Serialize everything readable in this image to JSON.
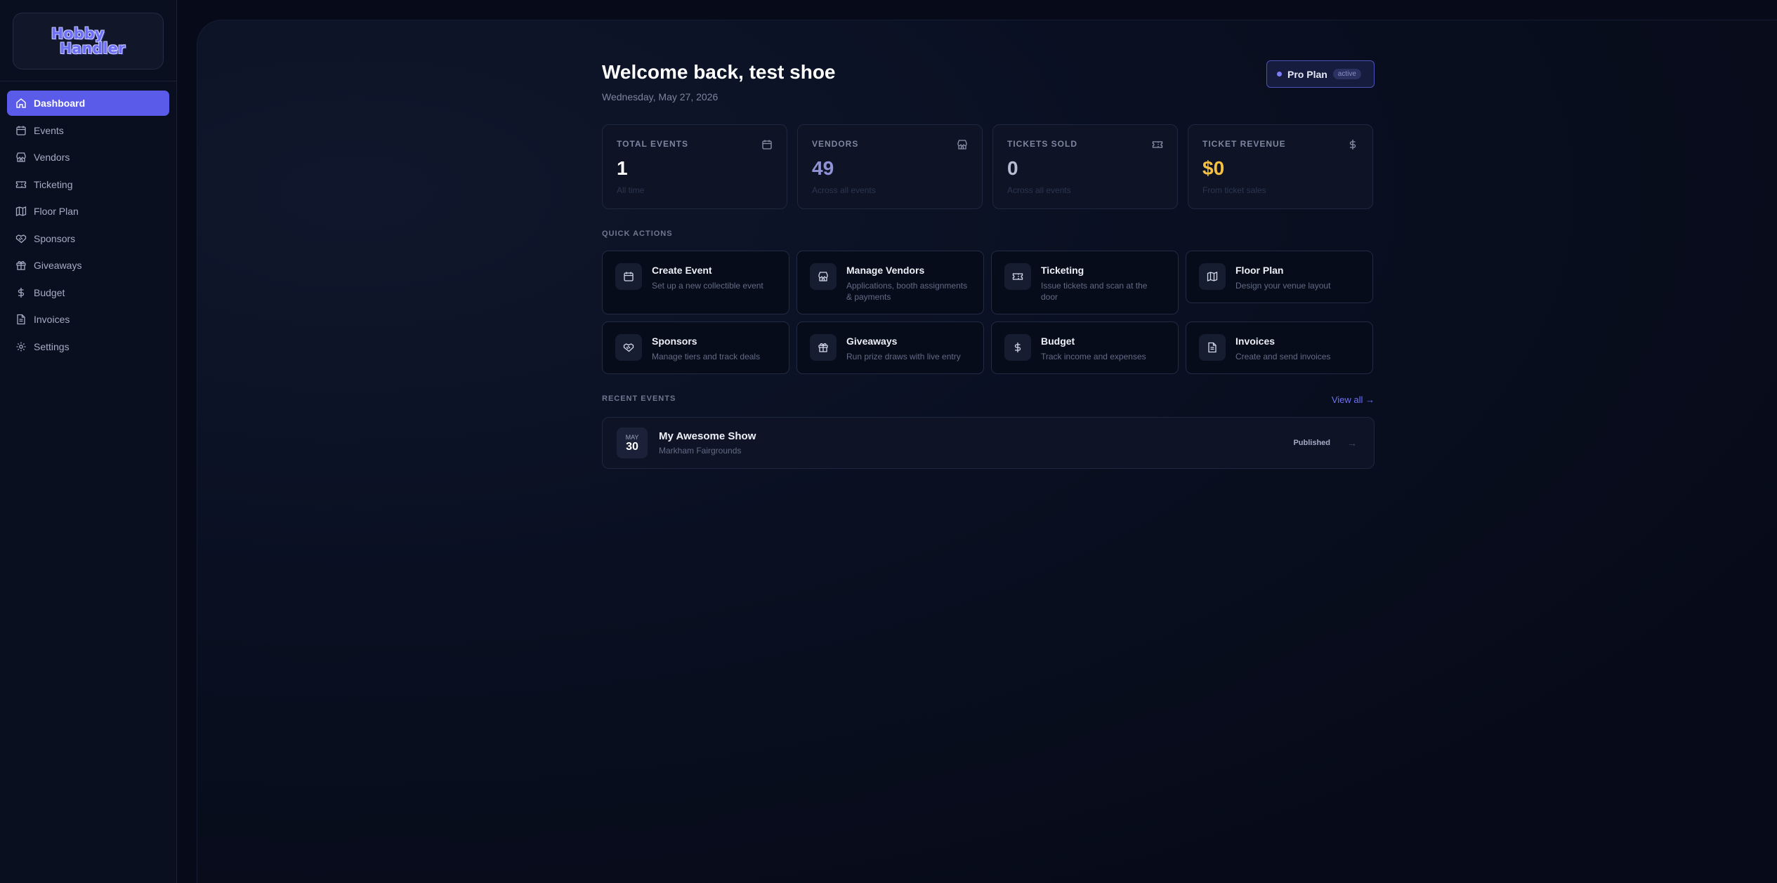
{
  "app": {
    "logo_line1": "Hobby",
    "logo_line2": "Handler"
  },
  "sidebar": {
    "items": [
      {
        "label": "Dashboard",
        "icon": "home-icon",
        "active": true
      },
      {
        "label": "Events",
        "icon": "calendar-icon"
      },
      {
        "label": "Vendors",
        "icon": "store-icon"
      },
      {
        "label": "Ticketing",
        "icon": "ticket-icon"
      },
      {
        "label": "Floor Plan",
        "icon": "map-icon"
      },
      {
        "label": "Sponsors",
        "icon": "handshake-icon"
      },
      {
        "label": "Giveaways",
        "icon": "gift-icon"
      },
      {
        "label": "Budget",
        "icon": "dollar-icon"
      },
      {
        "label": "Invoices",
        "icon": "file-icon"
      },
      {
        "label": "Settings",
        "icon": "gear-icon"
      }
    ]
  },
  "header": {
    "title": "Welcome back, test shoe",
    "date": "Wednesday, May 27, 2026",
    "plan_label": "Pro Plan",
    "plan_badge": "active"
  },
  "stats": [
    {
      "label": "TOTAL EVENTS",
      "value": "1",
      "sub": "All time",
      "icon": "calendar-icon",
      "color": "#ffffff"
    },
    {
      "label": "VENDORS",
      "value": "49",
      "sub": "Across all events",
      "icon": "store-icon",
      "color": "#8f93d6"
    },
    {
      "label": "TICKETS SOLD",
      "value": "0",
      "sub": "Across all events",
      "icon": "ticket-icon",
      "color": "#b6bdd2"
    },
    {
      "label": "TICKET REVENUE",
      "value": "$0",
      "sub": "From ticket sales",
      "icon": "dollar-icon",
      "color": "#f4c041"
    }
  ],
  "quick_actions": {
    "label": "QUICK ACTIONS",
    "items": [
      {
        "title": "Create Event",
        "desc": "Set up a new collectible event",
        "icon": "calendar-icon"
      },
      {
        "title": "Manage Vendors",
        "desc": "Applications, booth assignments & payments",
        "icon": "store-icon"
      },
      {
        "title": "Ticketing",
        "desc": "Issue tickets and scan at the door",
        "icon": "ticket-icon"
      },
      {
        "title": "Floor Plan",
        "desc": "Design your venue layout",
        "icon": "map-icon"
      },
      {
        "title": "Sponsors",
        "desc": "Manage tiers and track deals",
        "icon": "handshake-icon"
      },
      {
        "title": "Giveaways",
        "desc": "Run prize draws with live entry",
        "icon": "gift-icon"
      },
      {
        "title": "Budget",
        "desc": "Track income and expenses",
        "icon": "dollar-icon"
      },
      {
        "title": "Invoices",
        "desc": "Create and send invoices",
        "icon": "file-icon"
      }
    ]
  },
  "recent_events": {
    "label": "RECENT EVENTS",
    "view_all": "View all →",
    "items": [
      {
        "month": "MAY",
        "day": "30",
        "name": "My Awesome Show",
        "location": "Markham Fairgrounds",
        "status": "Published",
        "arrow": "→"
      }
    ]
  },
  "colors": {
    "accent": "#5b5bea",
    "revenue": "#f4c041",
    "vendors": "#8f93d6"
  }
}
